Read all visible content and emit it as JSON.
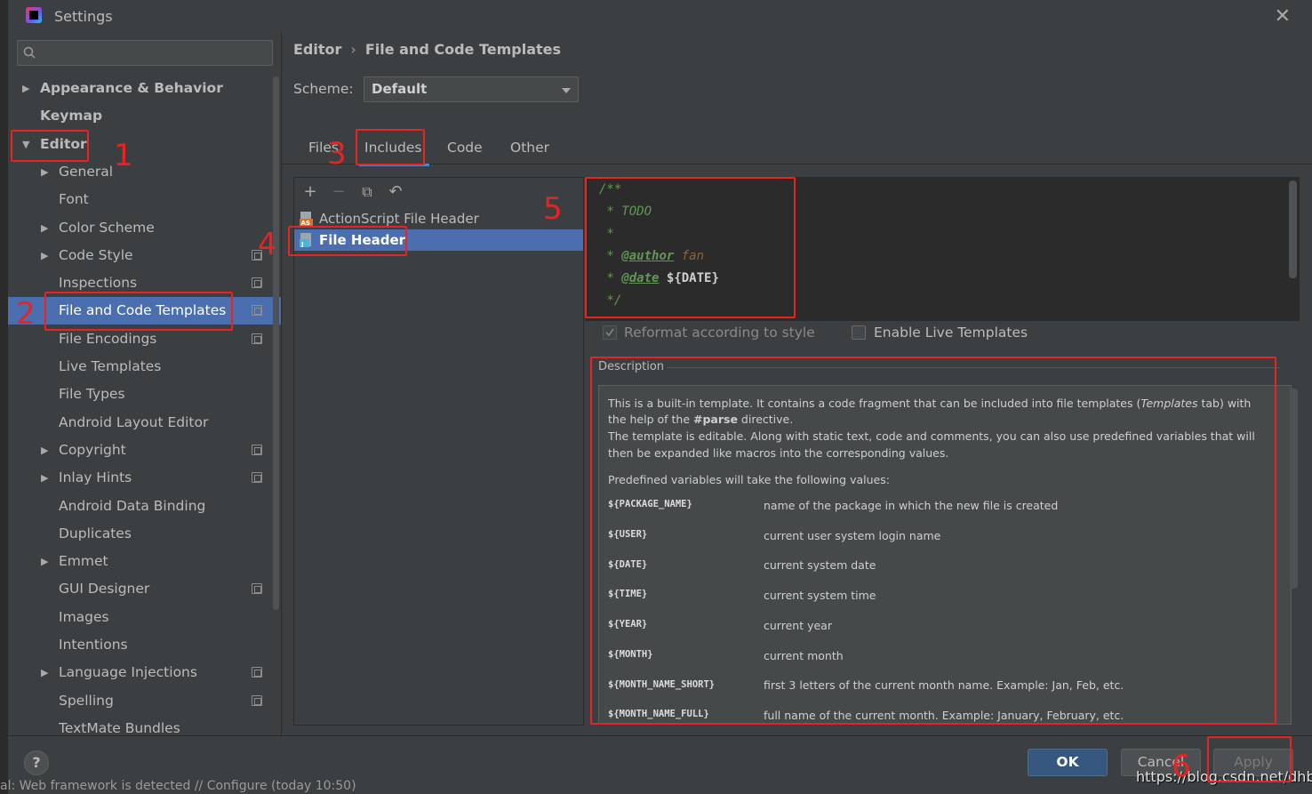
{
  "window": {
    "title": "Settings"
  },
  "search": {
    "placeholder": ""
  },
  "tree": [
    {
      "label": "Appearance & Behavior",
      "bold": true,
      "arrow": "right",
      "indent": 0,
      "cfg": false
    },
    {
      "label": "Keymap",
      "bold": true,
      "arrow": "none",
      "indent": 0,
      "cfg": false
    },
    {
      "label": "Editor",
      "bold": true,
      "arrow": "down",
      "indent": 0,
      "cfg": false
    },
    {
      "label": "General",
      "bold": false,
      "arrow": "right",
      "indent": 1,
      "cfg": false
    },
    {
      "label": "Font",
      "bold": false,
      "arrow": "none",
      "indent": 1,
      "cfg": false
    },
    {
      "label": "Color Scheme",
      "bold": false,
      "arrow": "right",
      "indent": 1,
      "cfg": false
    },
    {
      "label": "Code Style",
      "bold": false,
      "arrow": "right",
      "indent": 1,
      "cfg": true
    },
    {
      "label": "Inspections",
      "bold": false,
      "arrow": "none",
      "indent": 1,
      "cfg": true
    },
    {
      "label": "File and Code Templates",
      "bold": false,
      "arrow": "none",
      "indent": 1,
      "cfg": true,
      "selected": true
    },
    {
      "label": "File Encodings",
      "bold": false,
      "arrow": "none",
      "indent": 1,
      "cfg": true
    },
    {
      "label": "Live Templates",
      "bold": false,
      "arrow": "none",
      "indent": 1,
      "cfg": false
    },
    {
      "label": "File Types",
      "bold": false,
      "arrow": "none",
      "indent": 1,
      "cfg": false
    },
    {
      "label": "Android Layout Editor",
      "bold": false,
      "arrow": "none",
      "indent": 1,
      "cfg": false
    },
    {
      "label": "Copyright",
      "bold": false,
      "arrow": "right",
      "indent": 1,
      "cfg": true
    },
    {
      "label": "Inlay Hints",
      "bold": false,
      "arrow": "right",
      "indent": 1,
      "cfg": true
    },
    {
      "label": "Android Data Binding",
      "bold": false,
      "arrow": "none",
      "indent": 1,
      "cfg": false
    },
    {
      "label": "Duplicates",
      "bold": false,
      "arrow": "none",
      "indent": 1,
      "cfg": false
    },
    {
      "label": "Emmet",
      "bold": false,
      "arrow": "right",
      "indent": 1,
      "cfg": false
    },
    {
      "label": "GUI Designer",
      "bold": false,
      "arrow": "none",
      "indent": 1,
      "cfg": true
    },
    {
      "label": "Images",
      "bold": false,
      "arrow": "none",
      "indent": 1,
      "cfg": false
    },
    {
      "label": "Intentions",
      "bold": false,
      "arrow": "none",
      "indent": 1,
      "cfg": false
    },
    {
      "label": "Language Injections",
      "bold": false,
      "arrow": "right",
      "indent": 1,
      "cfg": true
    },
    {
      "label": "Spelling",
      "bold": false,
      "arrow": "none",
      "indent": 1,
      "cfg": true
    },
    {
      "label": "TextMate Bundles",
      "bold": false,
      "arrow": "none",
      "indent": 1,
      "cfg": false
    }
  ],
  "breadcrumb": {
    "parent": "Editor",
    "separator": "›",
    "current": "File and Code Templates"
  },
  "scheme": {
    "label": "Scheme:",
    "value": "Default"
  },
  "tabs": [
    "Files",
    "Includes",
    "Code",
    "Other"
  ],
  "active_tab": "Includes",
  "toolbar": {
    "add": "+",
    "remove": "−",
    "copy": "⧉",
    "reset": "↶"
  },
  "templates": [
    {
      "name": "ActionScript File Header",
      "selected": false
    },
    {
      "name": "File Header",
      "selected": true
    }
  ],
  "editor": {
    "line1": "/**",
    "line2": " * TODO",
    "line3": " *",
    "line4_prefix": " * ",
    "line4_tag": "@author",
    "line4_value": " fan",
    "line5_prefix": " * ",
    "line5_tag": "@date",
    "line5_value": "${DATE}",
    "line6": " */"
  },
  "options": {
    "reformat_label": "Reformat according to style",
    "reformat_checked": true,
    "live_templates_label": "Enable Live Templates",
    "live_templates_checked": false
  },
  "description": {
    "title": "Description",
    "para1_a": "This is a built-in template. It contains a code fragment that can be included into file templates (",
    "para1_em": "Templates",
    "para1_b": " tab) with the help of the ",
    "para1_strong": "#parse",
    "para1_c": " directive.",
    "para2": "The template is editable. Along with static text, code and comments, you can also use predefined variables that will then be expanded like macros into the corresponding values.",
    "para3": "Predefined variables will take the following values:",
    "vars": [
      {
        "name": "${PACKAGE_NAME}",
        "desc": "name of the package in which the new file is created"
      },
      {
        "name": "${USER}",
        "desc": "current user system login name"
      },
      {
        "name": "${DATE}",
        "desc": "current system date"
      },
      {
        "name": "${TIME}",
        "desc": "current system time"
      },
      {
        "name": "${YEAR}",
        "desc": "current year"
      },
      {
        "name": "${MONTH}",
        "desc": "current month"
      },
      {
        "name": "${MONTH_NAME_SHORT}",
        "desc": "first 3 letters of the current month name. Example: Jan, Feb, etc."
      },
      {
        "name": "${MONTH_NAME_FULL}",
        "desc": "full name of the current month. Example: January, February, etc."
      }
    ]
  },
  "buttons": {
    "help": "?",
    "ok": "OK",
    "cancel": "Cancel",
    "apply": "Apply"
  },
  "background_status": "al: Web framework is detected // Configure (today 10:50)",
  "watermark": "https://blog.csdn.net/dhbfjh",
  "annotations": [
    "1",
    "2",
    "3",
    "4",
    "5",
    "6"
  ],
  "colors": {
    "accent": "#4b6eaf",
    "annotation": "#e82323",
    "comment": "#629755",
    "ok_button": "#365880"
  }
}
